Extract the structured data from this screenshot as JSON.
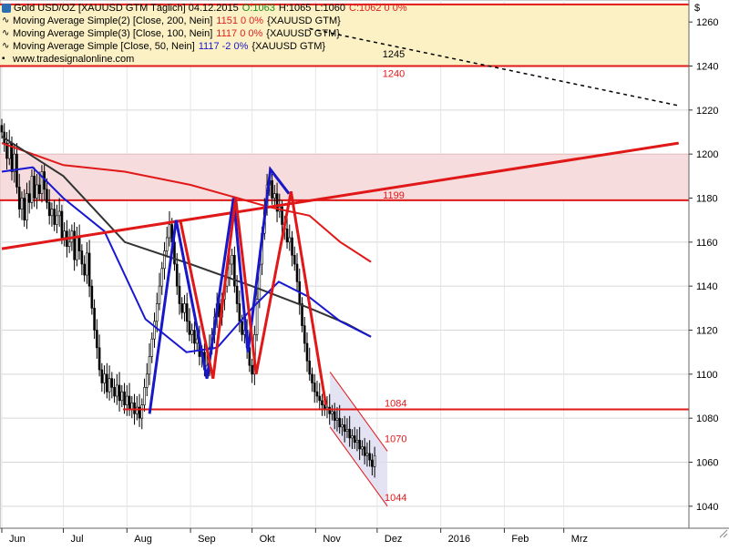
{
  "header": {
    "title": "Gold USD/OZ [XAUUSD GTM  Täglich] 04.12.2015",
    "ohlc": {
      "o": "O:1063",
      "h": "H:1065",
      "l": "L:1060",
      "c": "C:1062 0 0%"
    },
    "ma_rows": [
      {
        "label": "Moving Average Simple(2) [Close, 200, Nein]",
        "value": "1151 0 0%",
        "tail": "{XAUUSD GTM}"
      },
      {
        "label": "Moving Average Simple(3) [Close, 100, Nein]",
        "value": "1117 0 0%",
        "tail": "{XAUUSD GTM}"
      },
      {
        "label": "Moving Average Simple [Close, 50, Nein]",
        "value": "1117 -2 0%",
        "tail": "{XAUUSD GTM}"
      }
    ],
    "source": "www.tradesignalonline.com"
  },
  "currency_symbol": "$",
  "colors": {
    "up": "#1a8a1a",
    "down": "#e02020",
    "ma200": "#e01818",
    "ma100": "#333333",
    "ma50": "#1818d0",
    "pattern": "#1818c8",
    "trend": "#e01818",
    "zone_top": "#fbf1c4",
    "zone_mid": "#f6dcdc",
    "channel": "#dcdcf0"
  },
  "chart_data": {
    "type": "candlestick",
    "title": "Gold USD/OZ",
    "ylim": [
      1030,
      1270
    ],
    "yticks": [
      1040,
      1060,
      1080,
      1100,
      1120,
      1140,
      1160,
      1180,
      1200,
      1220,
      1240,
      1260
    ],
    "months": [
      {
        "label": "Jun",
        "t": 0
      },
      {
        "label": "Jul",
        "t": 30
      },
      {
        "label": "Aug",
        "t": 61
      },
      {
        "label": "Sep",
        "t": 92
      },
      {
        "label": "Okt",
        "t": 122
      },
      {
        "label": "Nov",
        "t": 153
      },
      {
        "label": "Dez",
        "t": 183
      },
      {
        "label": "2016",
        "t": 214
      },
      {
        "label": "Feb",
        "t": 245
      },
      {
        "label": "Mrz",
        "t": 274
      }
    ],
    "candle_close": [
      1210,
      1205,
      1198,
      1205,
      1192,
      1200,
      1185,
      1175,
      1180,
      1170,
      1182,
      1178,
      1190,
      1180,
      1186,
      1182,
      1192,
      1184,
      1178,
      1172,
      1175,
      1168,
      1172,
      1174,
      1162,
      1165,
      1158,
      1160,
      1165,
      1152,
      1162,
      1156,
      1150,
      1145,
      1155,
      1140,
      1130,
      1120,
      1112,
      1102,
      1096,
      1100,
      1092,
      1098,
      1094,
      1090,
      1095,
      1088,
      1092,
      1086,
      1090,
      1084,
      1087,
      1082,
      1085,
      1080,
      1086,
      1094,
      1100,
      1108,
      1116,
      1124,
      1132,
      1140,
      1148,
      1156,
      1162,
      1168,
      1160,
      1150,
      1140,
      1132,
      1128,
      1132,
      1124,
      1118,
      1120,
      1114,
      1116,
      1108,
      1110,
      1102,
      1104,
      1112,
      1118,
      1126,
      1132,
      1126,
      1134,
      1140,
      1144,
      1150,
      1154,
      1140,
      1132,
      1124,
      1118,
      1120,
      1112,
      1104,
      1100,
      1118,
      1134,
      1150,
      1164,
      1176,
      1186,
      1188,
      1180,
      1182,
      1174,
      1176,
      1168,
      1166,
      1160,
      1162,
      1154,
      1150,
      1142,
      1132,
      1122,
      1114,
      1106,
      1100,
      1096,
      1092,
      1090,
      1088,
      1086,
      1084,
      1085,
      1082,
      1083,
      1079,
      1080,
      1076,
      1077,
      1074,
      1075,
      1071,
      1072,
      1069,
      1070,
      1066,
      1067,
      1063,
      1064,
      1061,
      1058,
      1063
    ],
    "first_trade_index_offset": 0,
    "ma200": [
      [
        0,
        1205
      ],
      [
        30,
        1195
      ],
      [
        60,
        1192
      ],
      [
        92,
        1186
      ],
      [
        115,
        1180
      ],
      [
        130,
        1176
      ],
      [
        150,
        1172
      ],
      [
        165,
        1160
      ],
      [
        180,
        1151
      ]
    ],
    "ma100": [
      [
        0,
        1208
      ],
      [
        30,
        1190
      ],
      [
        60,
        1160
      ],
      [
        92,
        1150
      ],
      [
        122,
        1140
      ],
      [
        150,
        1130
      ],
      [
        168,
        1123
      ],
      [
        180,
        1117
      ]
    ],
    "ma50": [
      [
        0,
        1192
      ],
      [
        15,
        1194
      ],
      [
        30,
        1180
      ],
      [
        50,
        1165
      ],
      [
        70,
        1125
      ],
      [
        90,
        1110
      ],
      [
        105,
        1112
      ],
      [
        122,
        1130
      ],
      [
        135,
        1142
      ],
      [
        150,
        1135
      ],
      [
        165,
        1124
      ],
      [
        180,
        1117
      ]
    ],
    "resistance_zone": {
      "top": 1268,
      "bottom": 1240,
      "label_top": "1245",
      "label_bottom": "1240"
    },
    "supply_zone": {
      "top": 1200,
      "bottom": 1179,
      "label": "1199"
    },
    "support_level": {
      "value": 1084,
      "label": "1084"
    },
    "level_1070": "1070",
    "level_1044": "1044",
    "trendline_up": {
      "from": [
        0,
        1157
      ],
      "to": [
        330,
        1205
      ]
    },
    "trendline_down_dashed": {
      "from": [
        150,
        1257
      ],
      "to": [
        330,
        1222
      ]
    },
    "pattern_blue": [
      [
        72,
        1082
      ],
      [
        85,
        1170
      ],
      [
        100,
        1098
      ],
      [
        113,
        1180
      ],
      [
        120,
        1110
      ],
      [
        131,
        1193
      ],
      [
        140,
        1182
      ]
    ],
    "pattern_red": [
      [
        87,
        1170
      ],
      [
        103,
        1098
      ],
      [
        114,
        1180
      ],
      [
        124,
        1100
      ],
      [
        141,
        1183
      ],
      [
        158,
        1086
      ]
    ],
    "channel": {
      "x0": 160,
      "x1": 188,
      "top0": 1101,
      "top1": 1065,
      "bot0": 1076,
      "bot1": 1040
    }
  }
}
